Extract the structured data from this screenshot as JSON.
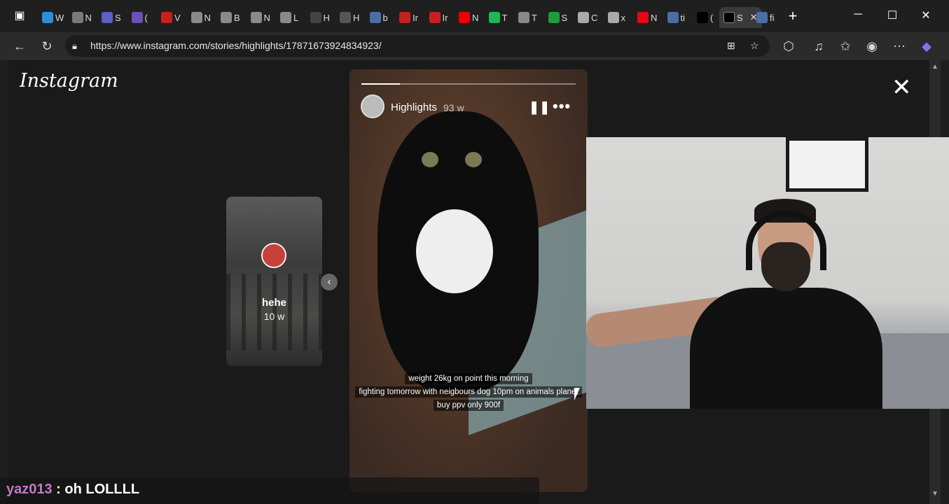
{
  "browser": {
    "tabs": [
      {
        "label": "W",
        "color": "#2b8fd6"
      },
      {
        "label": "N",
        "color": "#7a7a7a"
      },
      {
        "label": "S",
        "color": "#5b5fc7"
      },
      {
        "label": "(",
        "color": "#6b4fbb"
      },
      {
        "label": "V",
        "color": "#c5221f"
      },
      {
        "label": "N",
        "color": "#8a8a8a"
      },
      {
        "label": "B",
        "color": "#8a8a8a"
      },
      {
        "label": "N",
        "color": "#8a8a8a"
      },
      {
        "label": "L",
        "color": "#8a8a8a"
      },
      {
        "label": "H",
        "color": "#444"
      },
      {
        "label": "H",
        "color": "#555"
      },
      {
        "label": "b",
        "color": "#4a6fa5"
      },
      {
        "label": "Ir",
        "color": "#c5221f"
      },
      {
        "label": "Ir",
        "color": "#c5221f"
      },
      {
        "label": "N",
        "color": "#e00"
      },
      {
        "label": "T",
        "color": "#1db954"
      },
      {
        "label": "T",
        "color": "#888"
      },
      {
        "label": "S",
        "color": "#1f9c3a"
      },
      {
        "label": "C",
        "color": "#aaa"
      },
      {
        "label": "x",
        "color": "#aaa"
      },
      {
        "label": "N",
        "color": "#e50914"
      },
      {
        "label": "ti",
        "color": "#4a6fa5"
      },
      {
        "label": "(",
        "color": "#000"
      }
    ],
    "active_tab_label": "S",
    "last_tab_label": "fi",
    "new_tab": "+",
    "url": "https://www.instagram.com/stories/highlights/17871673924834923/"
  },
  "instagram": {
    "logo": "Instagram",
    "side_story": {
      "name": "hehe",
      "age": "10 w"
    },
    "story": {
      "user": "Highlights",
      "age": "93 w",
      "progress": 0.18,
      "caption_lines": [
        "weight 26kg on point this morning",
        "fighting tomorrow with neigbours dog 10pm on animals planet",
        "buy ppv only 900f"
      ]
    }
  },
  "chat": {
    "user": "yaz013",
    "message": " : oh LOLLLL"
  },
  "icons": {
    "back": "back-icon",
    "refresh": "refresh-icon",
    "lock": "lock-icon",
    "extensions": "extensions-icon",
    "favorites": "favorites-icon",
    "profile": "profile-icon",
    "close": "close-icon",
    "pause": "pause-icon",
    "more": "more-icon"
  }
}
